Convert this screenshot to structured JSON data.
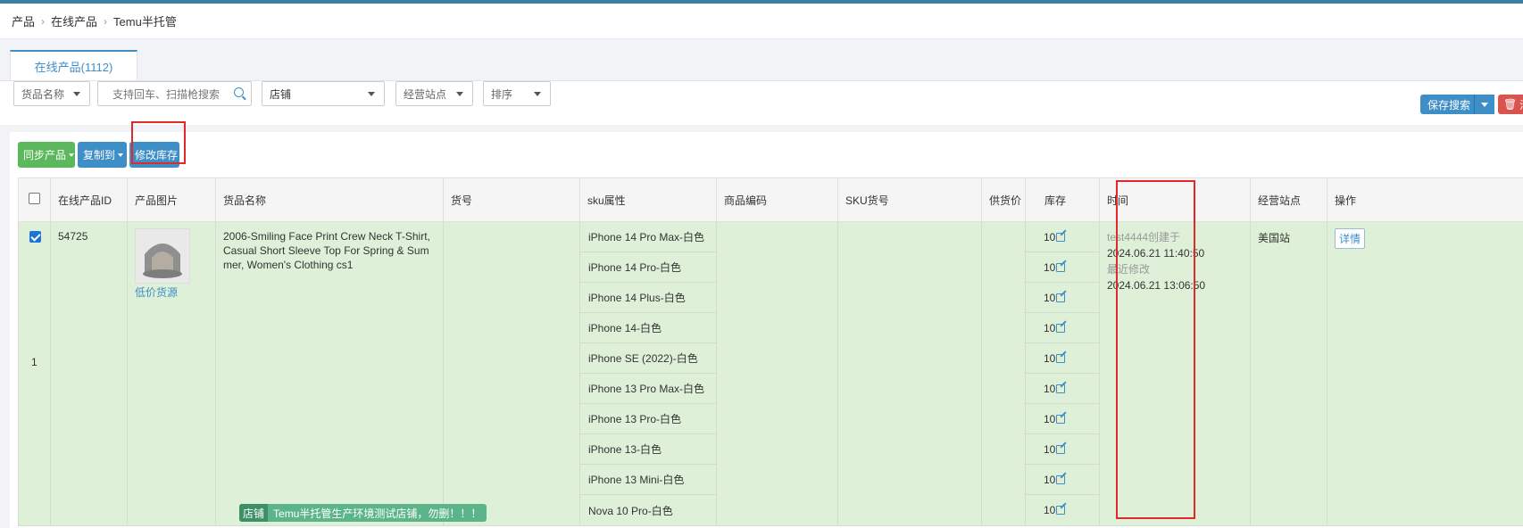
{
  "breadcrumb": [
    "产品",
    "在线产品",
    "Temu半托管"
  ],
  "tab": {
    "label": "在线产品(1112)"
  },
  "filters": {
    "name_field": "货品名称",
    "search_placeholder": "支持回车、扫描枪搜索",
    "store": "店铺",
    "site": "经营站点",
    "sort": "排序"
  },
  "right_buttons": {
    "save_search": "保存搜索",
    "clear": "清"
  },
  "actions": {
    "sync": "同步产品",
    "copy": "复制到",
    "modify_stock": "修改库存"
  },
  "table": {
    "headers": [
      "在线产品ID",
      "产品图片",
      "货品名称",
      "货号",
      "sku属性",
      "商品编码",
      "SKU货号",
      "供货价",
      "库存",
      "时间",
      "经营站点",
      "操作"
    ],
    "row": {
      "index": "1",
      "id": "54725",
      "image_link": "低价货源",
      "name": "2006-Smiling Face Print Crew Neck T-Shirt, Casual Short Sleeve Top For Spring & Summer, Women's Clothing cs1",
      "store_tag_label": "店铺",
      "store_tag_text": "Temu半托管生产环境测试店铺，勿删！！！",
      "skus": [
        "iPhone 14 Pro Max-白色",
        "iPhone 14 Pro-白色",
        "iPhone 14 Plus-白色",
        "iPhone 14-白色",
        "iPhone SE (2022)-白色",
        "iPhone 13 Pro Max-白色",
        "iPhone 13 Pro-白色",
        "iPhone 13-白色",
        "iPhone 13 Mini-白色",
        "Nova 10 Pro-白色"
      ],
      "stock": [
        "10",
        "10",
        "10",
        "10",
        "10",
        "10",
        "10",
        "10",
        "10",
        "10"
      ],
      "created_by": "test4444创建于",
      "created_at": "2024.06.21 11:40:50",
      "modified_label": "最近修改",
      "modified_at": "2024.06.21 13:06:50",
      "site": "美国站",
      "detail": "详情"
    }
  },
  "colors": {
    "accent": "#3e8ec8",
    "green": "#5cb85c",
    "row_bg": "#dff0d8",
    "highlight": "#e02a2a"
  }
}
